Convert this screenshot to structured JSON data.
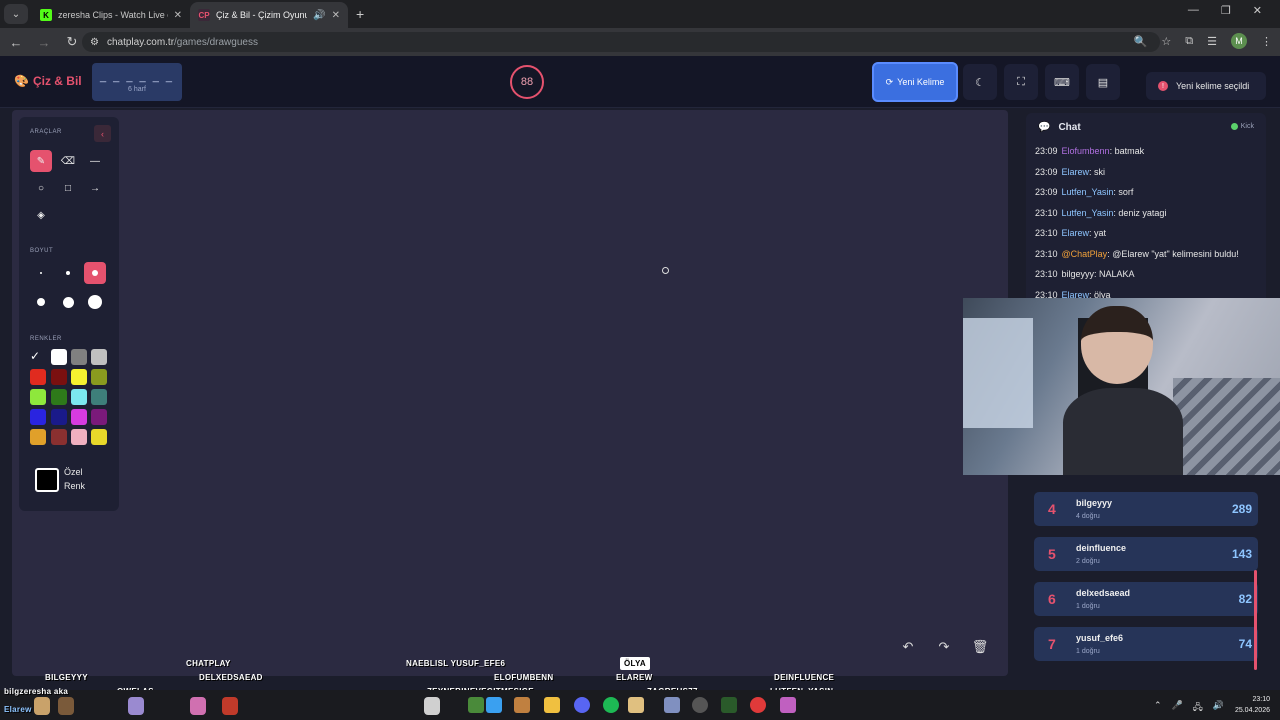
{
  "browser": {
    "tabs": [
      {
        "title": "zeresha Clips - Watch Live on K",
        "favicon": "K",
        "color": "#53fc18"
      },
      {
        "title": "Çiz & Bil - Çizim Oyunu",
        "favicon": "CP",
        "color": "#e5526e"
      }
    ],
    "url_host": "chatplay.com.tr",
    "url_path": "/games/drawguess",
    "profile_initial": "M"
  },
  "header": {
    "brand": "Çiz & Bil",
    "word_mask": "_ _ _ _ _ _",
    "word_length": "6 harf",
    "timer": "88",
    "new_word_label": "Yeni Kelime",
    "toast": "Yeni kelime seçildi",
    "colors": {
      "accent": "#e5526e",
      "primary": "#3b6fe0"
    }
  },
  "tools": {
    "section_tools": "ARAÇLAR",
    "section_size": "BOYUT",
    "section_colors": "RENKLER",
    "custom_line1": "Özel",
    "custom_line2": "Renk",
    "tool_icons": [
      "brush-icon",
      "eraser-icon",
      "line-icon",
      "circle-icon",
      "square-icon",
      "arrow-icon",
      "fill-bucket-icon"
    ],
    "sizes": [
      2,
      4,
      6,
      8,
      11,
      14
    ],
    "selected_size": 6,
    "palette": [
      "#ffffff",
      "#808080",
      "#c0c0c0",
      "#e02b1f",
      "#7a1010",
      "#f5f230",
      "#8a9b1f",
      "#8ee83c",
      "#2e7a1a",
      "#7ce8ef",
      "#3e7f7a",
      "#2a24e0",
      "#1a1a8a",
      "#d63be0",
      "#7a1a7a",
      "#e0a02a",
      "#8a3030",
      "#f0b0c0",
      "#e8d82a"
    ],
    "selected_color": "#000000"
  },
  "chat": {
    "title": "Chat",
    "status": "Kick",
    "messages": [
      {
        "time": "23:09",
        "user": "Elofumbenn",
        "user_color": "#b070e0",
        "text": "batmak"
      },
      {
        "time": "23:09",
        "user": "Elarew",
        "user_color": "#8ec5ff",
        "text": "ski"
      },
      {
        "time": "23:09",
        "user": "Lutfen_Yasin",
        "user_color": "#8ec5ff",
        "text": "sorf"
      },
      {
        "time": "23:10",
        "user": "Lutfen_Yasin",
        "user_color": "#8ec5ff",
        "text": "deniz yatagi"
      },
      {
        "time": "23:10",
        "user": "Elarew",
        "user_color": "#8ec5ff",
        "text": "yat"
      },
      {
        "time": "23:10",
        "user": "@ChatPlay",
        "user_color": "#f0a03a",
        "text": "@Elarew \"yat\" kelimesini buldu!"
      },
      {
        "time": "23:10",
        "user": "bilgeyyy",
        "user_color": "#e6e6e6",
        "text": "NALAKA"
      },
      {
        "time": "23:10",
        "user": "Elarew",
        "user_color": "#8ec5ff",
        "text": "ölya"
      }
    ]
  },
  "leaderboard": [
    {
      "rank": "4",
      "name": "bilgeyyy",
      "sub": "4 doğru",
      "score": "289"
    },
    {
      "rank": "5",
      "name": "deinfluence",
      "sub": "2 doğru",
      "score": "143"
    },
    {
      "rank": "6",
      "name": "delxedsaead",
      "sub": "1 doğru",
      "score": "82"
    },
    {
      "rank": "7",
      "name": "yusuf_efe6",
      "sub": "1 doğru",
      "score": "74"
    }
  ],
  "overlay": {
    "names": [
      "BILGEYYY",
      "CHATPLAY",
      "DELXEDSAEAD",
      "NAEBLISL YUSUF_EFE6",
      "ELOFUMBENN",
      "ÖLYA",
      "ELAREW",
      "DEINFLUENCE",
      "LUTFEN_YASIN",
      "ZEYNEBINEVEGITMESIGE",
      "ZAGREUS77",
      "OWELAS",
      "bilgzeresha  aka",
      "Elarew"
    ]
  },
  "taskbar": {
    "time": "23:10",
    "date": "25.04.2026"
  }
}
